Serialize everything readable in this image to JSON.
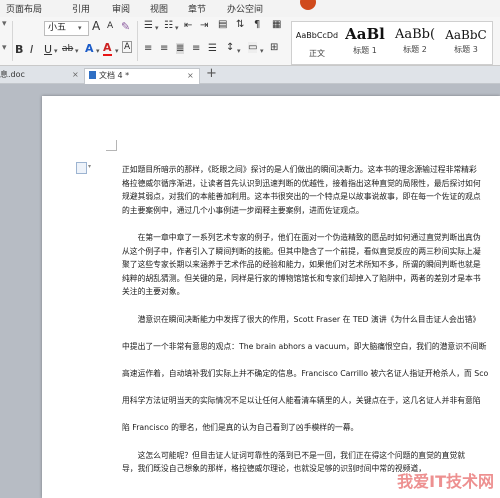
{
  "ribbon_tabs": [
    "页面布局",
    "引用",
    "审阅",
    "视图",
    "章节",
    "办公空间"
  ],
  "toolbar": {
    "font_size": "小五",
    "font_size_arrow": "▾",
    "grow_font": "A",
    "shrink_font": "A",
    "bold": "B",
    "italic": "I",
    "underline": "U",
    "strike": "ab",
    "font_color": "A",
    "highlight": "A"
  },
  "styles": [
    {
      "preview": "AaBbCcDd",
      "name": "正文"
    },
    {
      "preview": "AaBl",
      "name": "标题 1"
    },
    {
      "preview": "AaBb(",
      "name": "标题 2"
    },
    {
      "preview": "AaBbC",
      "name": "标题 3"
    }
  ],
  "doc_tabs": [
    {
      "label": "息.doc",
      "close": "×"
    },
    {
      "label": "文档 4 *",
      "close": "×"
    }
  ],
  "new_tab": "+",
  "document_lines": [
    "正如题目所暗示的那样，《眨眼之间》探讨的是人们做出的瞬间决断力。这本书的理念源输过程非常精彩",
    "格拉德威尔循序渐进，让读者首先认识到迅速判断的优越性，接着指出这种直觉的局限性，最后探讨如何",
    "规避其弱点，对我们的本能善加利用。这本书很突出的一个特点是以故事说故事，即在每一个佐证的观点",
    "的主要案例中，通过几个小事例进一步阐释主要案例，进而佐证观点。",
    "",
    "　　在第一章中章了一系列艺术专家的例子，他们在面对一个伪造精致的愿品时如何通过直觉判断出真伪",
    "从这个例子中，作者引入了瞬间判断的技能。但其中隐含了一个前提，看似直觉反应的两三秒间实际上凝",
    "聚了这些专家长期以来涵养于艺术作品的经验和能力，如果他们对艺术所知不多，所谓的瞬间判断也就是",
    "纯粹的胡乱猜测。但关键的是，同样是行家的博物馆馆长和专家们却掉入了陷阱中，两者的差别才是本书",
    "关注的主要对象。",
    "",
    "　　潜意识在瞬间决断能力中发挥了很大的作用，Scott Fraser 在 TED 演讲《为什么目击证人会出错》",
    "",
    "中提出了一个非常有意思的观点：The brain abhors a vacuum，即大脑痛恨空白，我们的潜意识不间断",
    "",
    "高速运作着，自动填补我们实际上并不确定的信息。Francisco Carrillo 被六名证人指证开枪杀人，而 Sco",
    "",
    "用科学方法证明当天的实际情况不足以让任何人能看清车辆里的人，关键点在于，这几名证人并非有意陷",
    "",
    "陷 Francisco 的罪名，他们是真的认为自己看到了凶手模样的一幕。",
    "",
    "　　这怎么可能呢？但目击证人证词可靠性的落到已不是一回，我们正在得这个问题的直觉的直觉就",
    "导，我们既没自己想象的那样，格拉德威尔理论，也就没足够的识别时间中常的视频道，"
  ],
  "watermark": "我爱IT技术网"
}
